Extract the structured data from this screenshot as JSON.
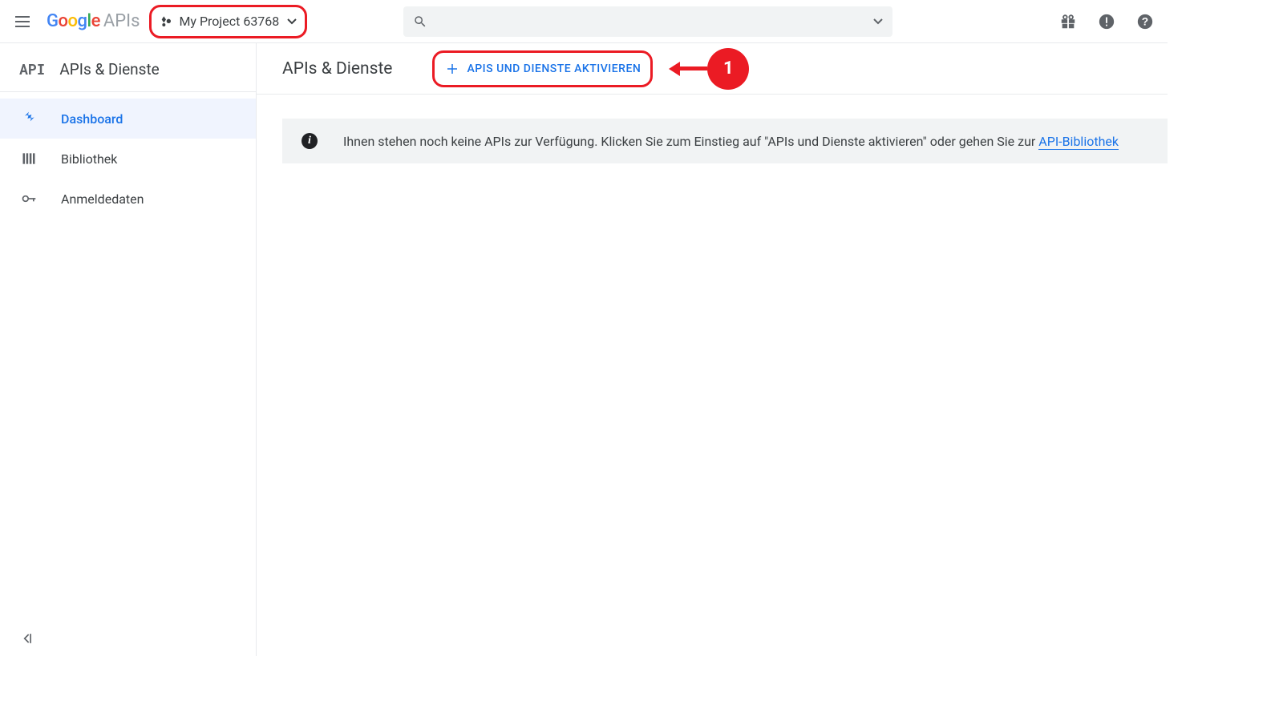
{
  "header": {
    "logo_suffix": "APIs",
    "project_name": "My Project 63768"
  },
  "sidebar": {
    "badge": "API",
    "title": "APIs & Dienste",
    "items": [
      {
        "label": "Dashboard",
        "active": true
      },
      {
        "label": "Bibliothek",
        "active": false
      },
      {
        "label": "Anmeldedaten",
        "active": false
      }
    ]
  },
  "main": {
    "page_title": "APIs & Dienste",
    "activate_label": "APIS UND DIENSTE AKTIVIEREN",
    "notice_text": "Ihnen stehen noch keine APIs zur Verfügung. Klicken Sie zum Einstieg auf \"APIs und Dienste aktivieren\" oder gehen Sie zur ",
    "notice_link": "API-Bibliothek"
  },
  "annotation": {
    "badge": "1"
  }
}
